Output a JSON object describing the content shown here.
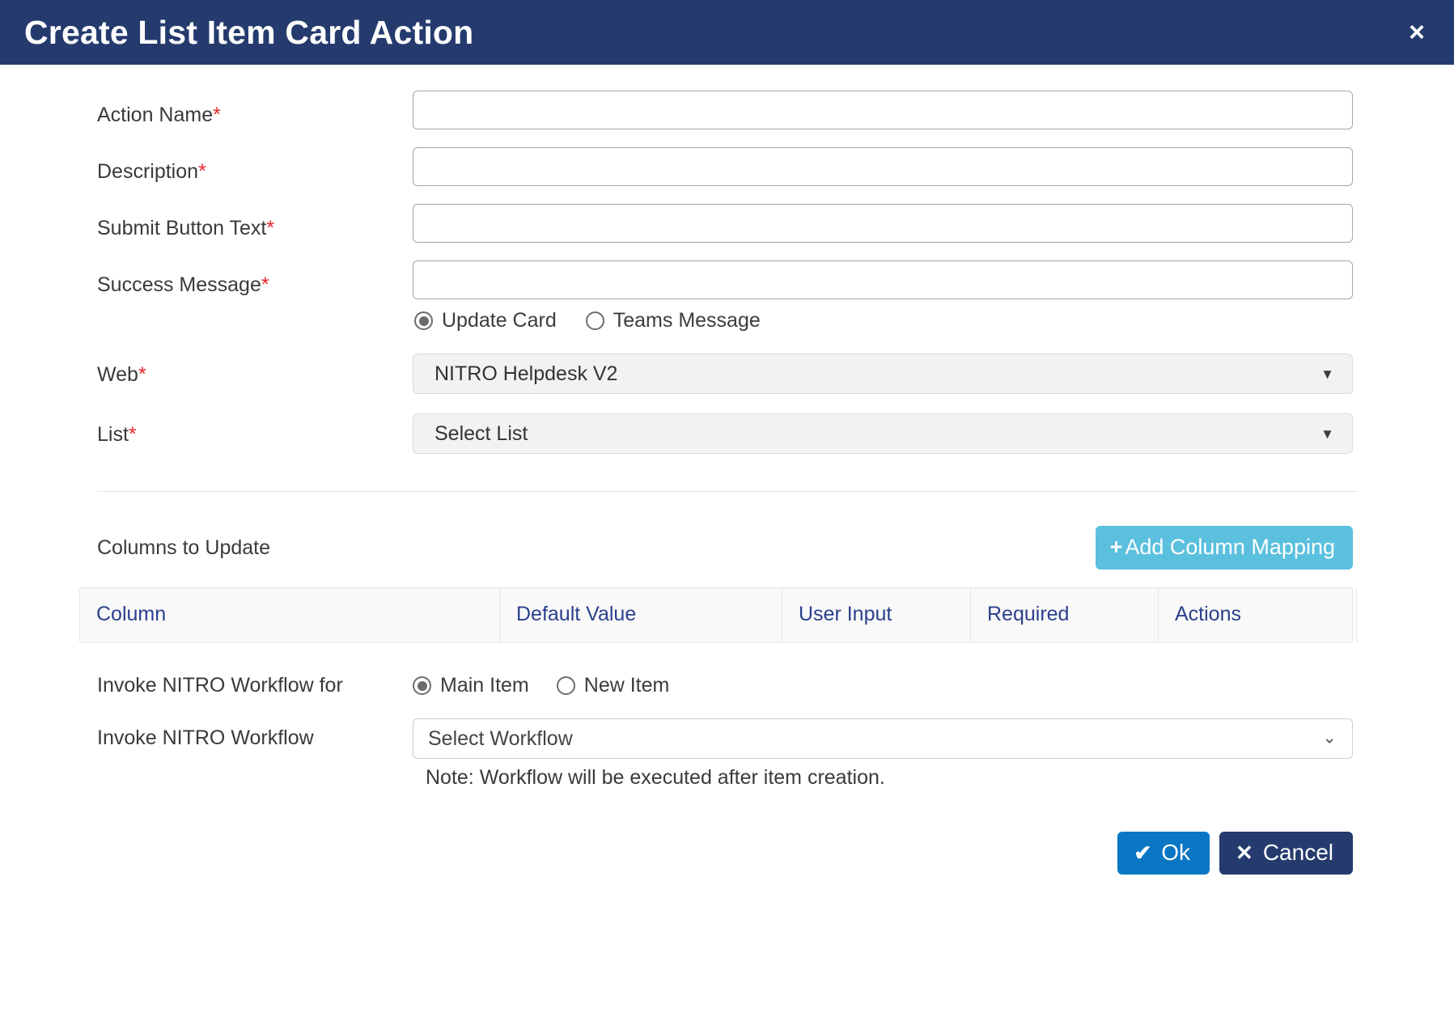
{
  "header": {
    "title": "Create List Item Card Action",
    "close_label": "×",
    "bg_color": "#253b6e"
  },
  "form": {
    "fields": [
      {
        "label": "Action Name",
        "required_mark": "*",
        "value": "",
        "placeholder": ""
      },
      {
        "label": "Description",
        "required_mark": "*",
        "value": "",
        "placeholder": ""
      },
      {
        "label": "Submit Button Text",
        "required_mark": "*",
        "value": "",
        "placeholder": ""
      },
      {
        "label": "Success Message",
        "required_mark": "*",
        "value": "",
        "placeholder": ""
      }
    ],
    "message_type_radios": [
      {
        "label": "Update Card",
        "selected": true
      },
      {
        "label": "Teams Message",
        "selected": false
      }
    ],
    "web": {
      "label": "Web",
      "required_mark": "*",
      "selected": "NITRO Helpdesk V2",
      "caret": "▼"
    },
    "list": {
      "label": "List",
      "required_mark": "*",
      "selected": "Select List",
      "caret": "▼"
    }
  },
  "columns_section": {
    "title": "Columns to Update",
    "add_button": {
      "plus": "+",
      "label": "Add Column Mapping",
      "color": "#5bc0de"
    },
    "table": {
      "headers": [
        "Column",
        "Default Value",
        "User Input",
        "Required",
        "Actions",
        ""
      ],
      "rows": []
    }
  },
  "workflow": {
    "invoke_for_label": "Invoke NITRO Workflow for",
    "invoke_for_radios": [
      {
        "label": "Main Item",
        "selected": true
      },
      {
        "label": "New Item",
        "selected": false
      }
    ],
    "invoke_label": "Invoke NITRO Workflow",
    "selected_workflow": "Select Workflow",
    "chevron": "⌄",
    "note": "Note: Workflow will be executed after item creation."
  },
  "footer": {
    "ok": {
      "glyph": "✔",
      "label": "Ok",
      "color": "#0a77c4"
    },
    "cancel": {
      "glyph": "✕",
      "label": "Cancel",
      "color": "#253b6e"
    }
  }
}
